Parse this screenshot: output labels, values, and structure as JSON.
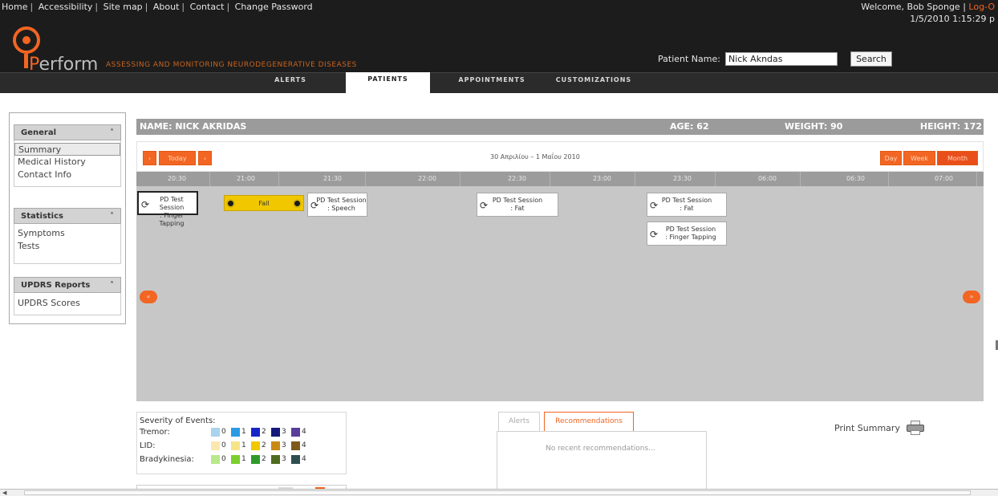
{
  "top_links": [
    "Home",
    "Accessibility",
    "Site map",
    "About",
    "Contact",
    "Change Password"
  ],
  "welcome": {
    "text": "Welcome,  Bob Sponge | ",
    "logout": "Log-O"
  },
  "datetime": "1/5/2010 1:15:29 p",
  "logo": {
    "word_a": "P",
    "word_b": "erform",
    "tagline": "ASSESSING AND MONITORING NEURODEGENERATIVE DISEASES"
  },
  "patient_search": {
    "label": "Patient Name:",
    "value": "Nick Akndas",
    "button": "Search"
  },
  "nav": {
    "alerts": "ALERTS",
    "patients": "PATIENTS",
    "appointments": "APPOINTMENTS",
    "customizations": "CUSTOMIZATIONS"
  },
  "sidebar": {
    "general": {
      "title": "General",
      "toggle": "˄",
      "items": [
        "Summary",
        "Medical History",
        "Contact Info"
      ]
    },
    "statistics": {
      "title": "Statistics",
      "toggle": "˄",
      "items": [
        "Symptoms",
        "Tests"
      ]
    },
    "updrs": {
      "title": "UPDRS Reports",
      "toggle": "˄",
      "items": [
        "UPDRS Scores"
      ]
    }
  },
  "patient": {
    "name": "NAME: NICK AKRIDAS",
    "age": "AGE: 62",
    "weight": "WEIGHT: 90",
    "height": "HEIGHT: 172"
  },
  "calendar": {
    "prev": "‹",
    "today": "Today",
    "next": "›",
    "range": "30 Απριλίου – 1 Μαΐου 2010",
    "view_day": "Day",
    "view_week": "Week",
    "view_month": "Month",
    "hours": [
      "20:30",
      "21:00",
      "21:30",
      "22:00",
      "22:30",
      "23:00",
      "23:30",
      "06:00",
      "06:30",
      "07:00"
    ],
    "scroll_left": "«",
    "scroll_right": "»",
    "events": {
      "e1": [
        "PD Test Session",
        ": Finger Tapping"
      ],
      "fall": "Fall",
      "e2": [
        "PD Test Session",
        ": Speech"
      ],
      "e3": [
        "PD Test Session",
        ": Fat"
      ],
      "e4": [
        "PD Test Session",
        ": Fat"
      ],
      "e5": [
        "PD Test Session",
        ": Finger Tapping"
      ]
    }
  },
  "legend": {
    "title": "Severity of Events:",
    "rows": [
      {
        "name": "Tremor:",
        "levels": [
          "0",
          "1",
          "2",
          "3",
          "4"
        ],
        "colors": [
          "#a9d3ee",
          "#2a9be3",
          "#1526c8",
          "#15197a",
          "#5a3d9a"
        ]
      },
      {
        "name": "LID:",
        "levels": [
          "0",
          "1",
          "2",
          "3",
          "4"
        ],
        "colors": [
          "#fbe7b0",
          "#f6e489",
          "#f1c800",
          "#c98a14",
          "#7e5b1d"
        ]
      },
      {
        "name": "Bradykinesia:",
        "levels": [
          "0",
          "1",
          "2",
          "3",
          "4"
        ],
        "colors": [
          "#b8e98a",
          "#7ccf2c",
          "#2f9a2b",
          "#4f6b1f",
          "#2f4f4f"
        ]
      }
    ]
  },
  "bottom_tabs": {
    "alerts": "Alerts",
    "recommendations": "Recommendations",
    "message": "No recent recommendations..."
  },
  "print_summary": "Print Summary"
}
